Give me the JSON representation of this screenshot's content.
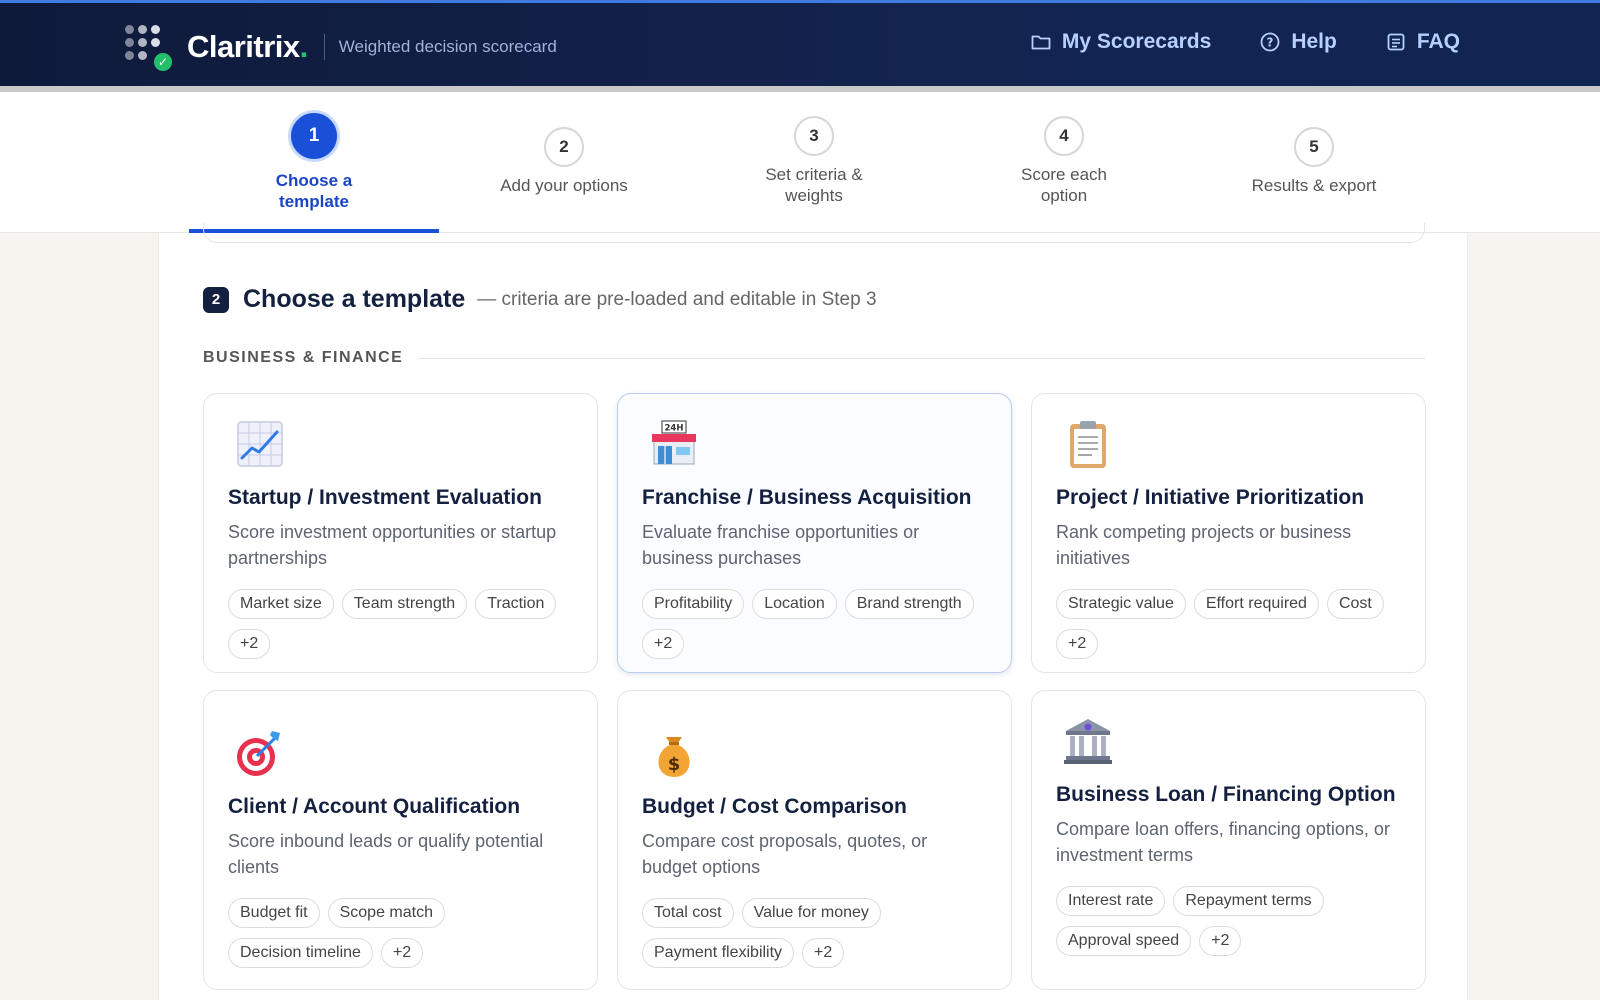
{
  "header": {
    "brand_name": "Claritrix",
    "brand_dot": ".",
    "tagline": "Weighted decision scorecard",
    "nav": [
      {
        "label": "My Scorecards",
        "icon": "folder-icon"
      },
      {
        "label": "Help",
        "icon": "help-circle-icon"
      },
      {
        "label": "FAQ",
        "icon": "document-icon"
      }
    ]
  },
  "stepper": {
    "steps": [
      {
        "number": "1",
        "label_line1": "Choose a",
        "label_line2": "template",
        "active": true
      },
      {
        "number": "2",
        "label_line1": "Add your options",
        "label_line2": ""
      },
      {
        "number": "3",
        "label_line1": "Set criteria &",
        "label_line2": "weights"
      },
      {
        "number": "4",
        "label_line1": "Score each",
        "label_line2": "option"
      },
      {
        "number": "5",
        "label_line1": "Results & export",
        "label_line2": ""
      }
    ]
  },
  "section": {
    "number": "2",
    "title": "Choose a template",
    "subtitle": "— criteria are pre-loaded and editable in Step 3",
    "category": "BUSINESS & FINANCE"
  },
  "templates": [
    {
      "icon": "chart-increasing-icon",
      "title": "Startup / Investment Evaluation",
      "description": "Score investment opportunities or startup partnerships",
      "tags": [
        "Market size",
        "Team strength",
        "Traction",
        "+2"
      ]
    },
    {
      "icon": "convenience-store-icon",
      "title": "Franchise / Business Acquisition",
      "description": "Evaluate franchise opportunities or business purchases",
      "tags": [
        "Profitability",
        "Location",
        "Brand strength",
        "+2"
      ]
    },
    {
      "icon": "clipboard-icon",
      "title": "Project / Initiative Prioritization",
      "description": "Rank competing projects or business initiatives",
      "tags": [
        "Strategic value",
        "Effort required",
        "Cost",
        "+2"
      ]
    },
    {
      "icon": "target-icon",
      "title": "Client / Account Qualification",
      "description": "Score inbound leads or qualify potential clients",
      "tags": [
        "Budget fit",
        "Scope match",
        "Decision timeline",
        "+2"
      ]
    },
    {
      "icon": "money-bag-icon",
      "title": "Budget / Cost Comparison",
      "description": "Compare cost proposals, quotes, or budget options",
      "tags": [
        "Total cost",
        "Value for money",
        "Payment flexibility",
        "+2"
      ]
    },
    {
      "icon": "bank-icon",
      "title": "Business Loan / Financing Option",
      "description": "Compare loan offers, financing options, or investment terms",
      "tags": [
        "Interest rate",
        "Repayment terms",
        "Approval speed",
        "+2"
      ]
    }
  ]
}
